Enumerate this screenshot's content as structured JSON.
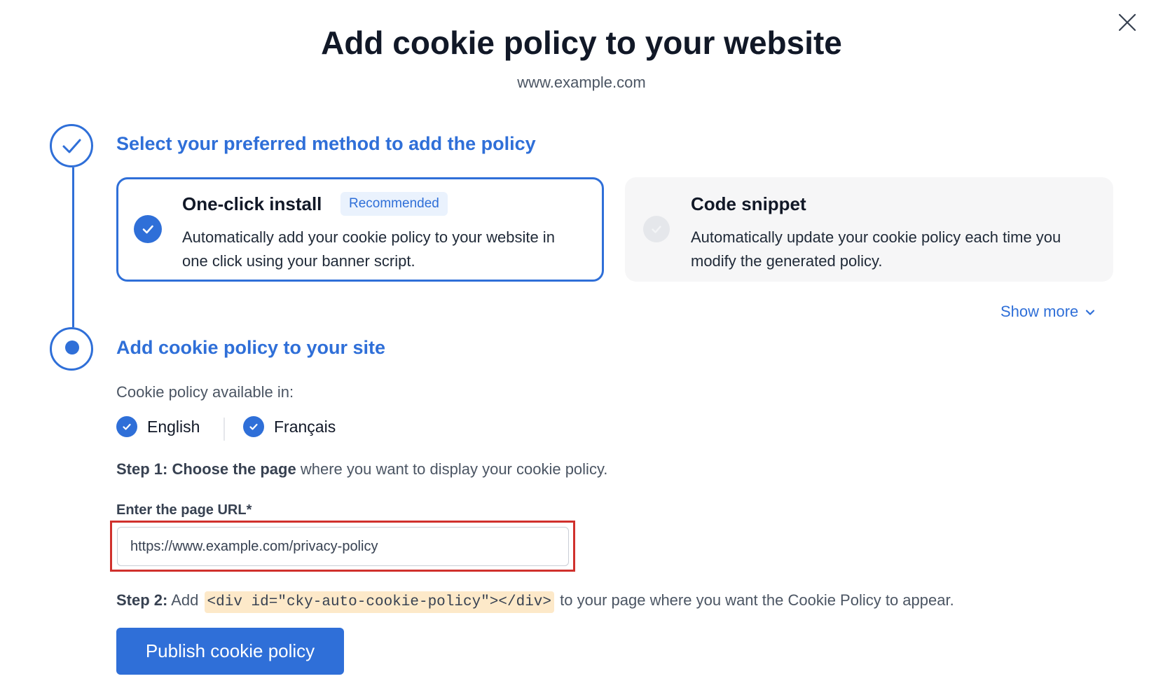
{
  "header": {
    "title": "Add cookie policy to your website",
    "subtitle": "www.example.com",
    "close_icon": "close-icon"
  },
  "steps": [
    {
      "heading": "Select your preferred method to add the policy",
      "state": "completed",
      "icon": "check-icon"
    },
    {
      "heading": "Add cookie policy to your site",
      "state": "current",
      "icon": "dot-icon"
    }
  ],
  "methods": {
    "one_click": {
      "title": "One-click install",
      "badge": "Recommended",
      "description": "Automatically add your cookie policy to your website in one click using your banner script.",
      "selected": true
    },
    "code_snippet": {
      "title": "Code snippet",
      "description": "Automatically update your cookie policy each time you modify the generated policy.",
      "selected": false
    },
    "show_more": "Show more",
    "show_more_icon": "chevron-down-icon"
  },
  "languages": {
    "label": "Cookie policy available in:",
    "items": [
      {
        "name": "English",
        "checked": true
      },
      {
        "name": "Français",
        "checked": true
      }
    ]
  },
  "step1": {
    "bold": "Step 1: Choose the page",
    "rest": " where you want to display your cookie policy."
  },
  "url_field": {
    "label": "Enter the page URL*",
    "value": "https://www.example.com/privacy-policy"
  },
  "step2": {
    "bold": "Step 2:",
    "pre": " Add",
    "code": "<div id=\"cky-auto-cookie-policy\"></div>",
    "post": "to your page where you want the Cookie Policy to appear."
  },
  "publish_button": "Publish cookie policy",
  "colors": {
    "accent": "#2f6fd8",
    "highlight_border": "#d0312d",
    "code_bg": "#fde9c9"
  }
}
